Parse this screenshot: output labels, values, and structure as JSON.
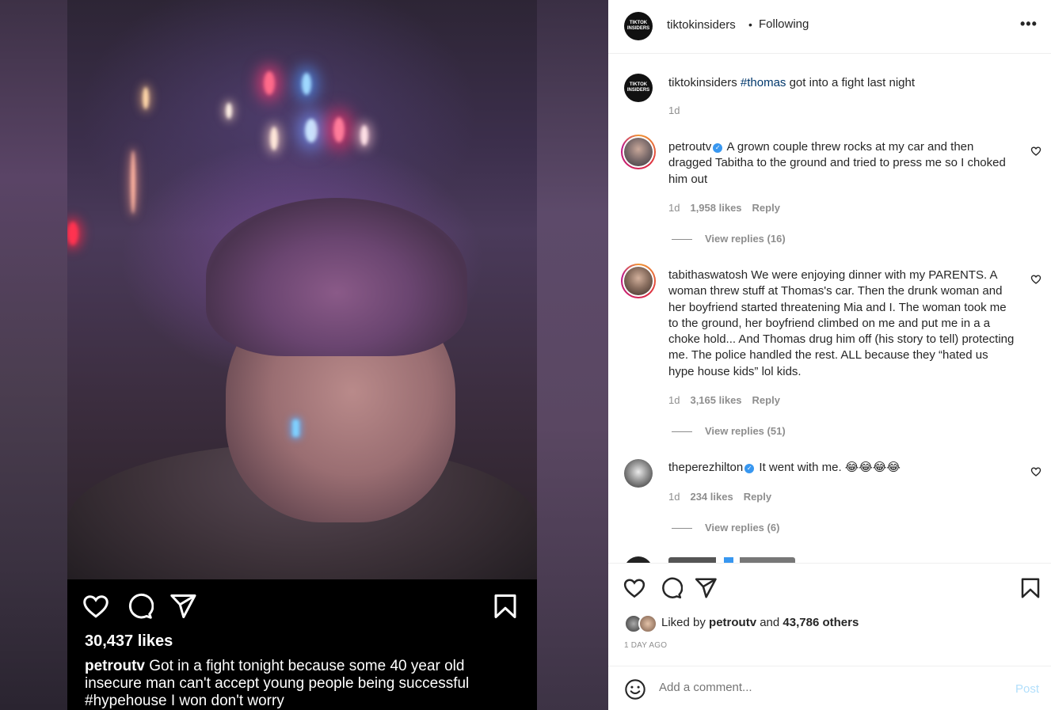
{
  "post": {
    "likes": "30,437 likes",
    "caption_user": "petroutv",
    "caption_text": "Got in a fight tonight because some 40 year old insecure man can't accept young people being successful #hypehouse I won don't worry"
  },
  "header": {
    "username": "tiktokinsiders",
    "separator": "•",
    "follow_status": "Following",
    "more": "•••",
    "avatar_text": "TIKTOK INSIDERS"
  },
  "caption_comment": {
    "username": "tiktokinsiders",
    "hashtag": "#thomas",
    "text": " got into a fight last night",
    "time": "1d"
  },
  "comments": [
    {
      "username": "petroutv",
      "text": "A grown couple threw rocks at my car and then dragged Tabitha to the ground and tried to press me so I choked him out",
      "time": "1d",
      "likes": "1,958 likes",
      "reply": "Reply",
      "view_replies": "View replies (16)"
    },
    {
      "username": "tabithaswatosh",
      "text": "We were enjoying dinner with my PARENTS. A woman threw stuff at Thomas's car. Then the drunk woman and her boyfriend started threatening Mia and I. The woman took me to the ground, her boyfriend climbed on me and put me in a a choke hold... And Thomas drug him off (his story to tell) protecting me. The police handled the rest. ALL because they “hated us hype house kids” lol kids.",
      "time": "1d",
      "likes": "3,165 likes",
      "reply": "Reply",
      "view_replies": "View replies (51)"
    },
    {
      "username": "theperezhilton",
      "text": "It went with me. 😂😂😂😂",
      "time": "1d",
      "likes": "234 likes",
      "reply": "Reply",
      "view_replies": "View replies (6)"
    }
  ],
  "actions": {
    "liked_by_prefix": "Liked by ",
    "liked_by_user": "petroutv",
    "liked_by_and": " and ",
    "liked_by_others": "43,786 others",
    "time_ago": "1 DAY AGO"
  },
  "add_comment": {
    "placeholder": "Add a comment...",
    "post_label": "Post"
  },
  "colors": {
    "link": "#00376b",
    "muted": "#8e8e8e",
    "post_disabled": "#b2dffc",
    "verified": "#3897f0"
  }
}
